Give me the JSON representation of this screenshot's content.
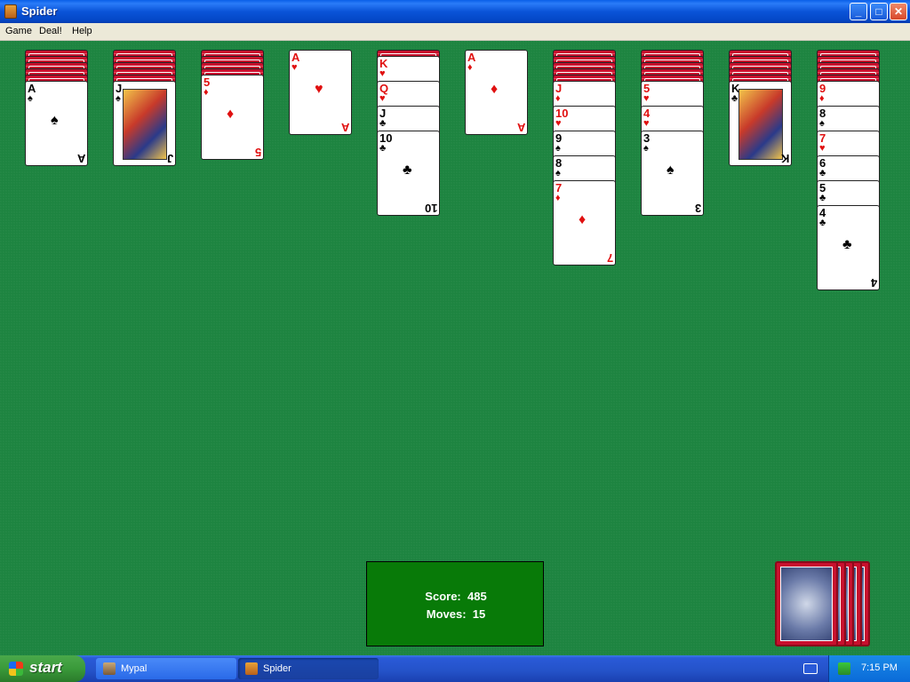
{
  "window": {
    "title": "Spider"
  },
  "menu": {
    "game": "Game",
    "deal": "Deal!",
    "help": "Help"
  },
  "status": {
    "score_label": "Score:",
    "score": "485",
    "moves_label": "Moves:",
    "moves": "15"
  },
  "taskbar": {
    "start": "start",
    "task1": "Mypal",
    "task2": "Spider",
    "clock": "7:15 PM"
  },
  "tableau": [
    {
      "backs": 5,
      "cards": [
        {
          "rank": "A",
          "suit": "♠",
          "color": "black"
        }
      ]
    },
    {
      "backs": 5,
      "cards": [
        {
          "rank": "J",
          "suit": "♠",
          "color": "black",
          "face": true
        }
      ]
    },
    {
      "backs": 4,
      "cards": [
        {
          "rank": "5",
          "suit": "♦",
          "color": "red"
        }
      ]
    },
    {
      "backs": 0,
      "cards": [
        {
          "rank": "A",
          "suit": "♥",
          "color": "red"
        }
      ]
    },
    {
      "backs": 1,
      "cards": [
        {
          "rank": "K",
          "suit": "♥",
          "color": "red"
        },
        {
          "rank": "Q",
          "suit": "♥",
          "color": "red"
        },
        {
          "rank": "J",
          "suit": "♣",
          "color": "black"
        },
        {
          "rank": "10",
          "suit": "♣",
          "color": "black"
        }
      ]
    },
    {
      "backs": 0,
      "cards": [
        {
          "rank": "A",
          "suit": "♦",
          "color": "red"
        }
      ]
    },
    {
      "backs": 5,
      "cards": [
        {
          "rank": "J",
          "suit": "♦",
          "color": "red"
        },
        {
          "rank": "10",
          "suit": "♥",
          "color": "red"
        },
        {
          "rank": "9",
          "suit": "♠",
          "color": "black"
        },
        {
          "rank": "8",
          "suit": "♠",
          "color": "black"
        },
        {
          "rank": "7",
          "suit": "♦",
          "color": "red"
        }
      ]
    },
    {
      "backs": 5,
      "cards": [
        {
          "rank": "5",
          "suit": "♥",
          "color": "red"
        },
        {
          "rank": "4",
          "suit": "♥",
          "color": "red"
        },
        {
          "rank": "3",
          "suit": "♠",
          "color": "black"
        }
      ]
    },
    {
      "backs": 5,
      "cards": [
        {
          "rank": "K",
          "suit": "♣",
          "color": "black",
          "face": true
        }
      ]
    },
    {
      "backs": 5,
      "cards": [
        {
          "rank": "9",
          "suit": "♦",
          "color": "red"
        },
        {
          "rank": "8",
          "suit": "♠",
          "color": "black"
        },
        {
          "rank": "7",
          "suit": "♥",
          "color": "red"
        },
        {
          "rank": "6",
          "suit": "♣",
          "color": "black"
        },
        {
          "rank": "5",
          "suit": "♣",
          "color": "black"
        },
        {
          "rank": "4",
          "suit": "♣",
          "color": "black"
        }
      ]
    }
  ],
  "stock": {
    "piles": 5
  }
}
